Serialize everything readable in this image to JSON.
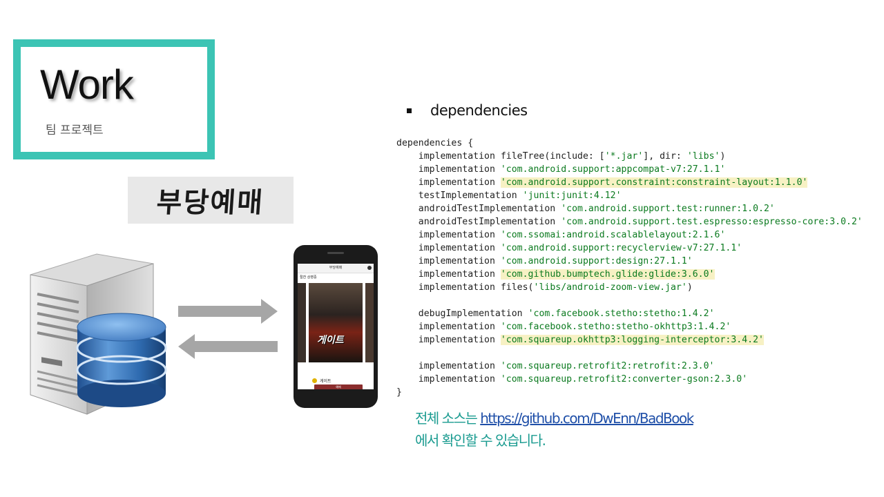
{
  "title": "Work",
  "subtitle": "팀 프로젝트",
  "logo_text": "부당예매",
  "dependencies_heading": "dependencies",
  "code_lines": [
    {
      "text": "dependencies {"
    },
    {
      "text": "    implementation fileTree(include: ['*.jar'], dir: 'libs')"
    },
    {
      "text": "    implementation 'com.android.support:appcompat-v7:27.1.1'"
    },
    {
      "text": "    implementation 'com.android.support.constraint:constraint-layout:1.1.0'",
      "highlight": true
    },
    {
      "text": "    testImplementation 'junit:junit:4.12'"
    },
    {
      "text": "    androidTestImplementation 'com.android.support.test:runner:1.0.2'"
    },
    {
      "text": "    androidTestImplementation 'com.android.support.test.espresso:espresso-core:3.0.2'"
    },
    {
      "text": "    implementation 'com.ssomai:android.scalablelayout:2.1.6'"
    },
    {
      "text": "    implementation 'com.android.support:recyclerview-v7:27.1.1'"
    },
    {
      "text": "    implementation 'com.android.support:design:27.1.1'"
    },
    {
      "text": "    implementation 'com.github.bumptech.glide:glide:3.6.0'",
      "highlight": true
    },
    {
      "text": "    implementation files('libs/android-zoom-view.jar')"
    },
    {
      "text": ""
    },
    {
      "text": "    debugImplementation 'com.facebook.stetho:stetho:1.4.2'"
    },
    {
      "text": "    implementation 'com.facebook.stetho:stetho-okhttp3:1.4.2'"
    },
    {
      "text": "    implementation 'com.squareup.okhttp3:logging-interceptor:3.4.2'",
      "highlight": true
    },
    {
      "text": ""
    },
    {
      "text": "    implementation 'com.squareup.retrofit2:retrofit:2.3.0'"
    },
    {
      "text": "    implementation 'com.squareup.retrofit2:converter-gson:2.3.0'"
    },
    {
      "text": "}"
    }
  ],
  "footer": {
    "prefix": "전체 소스는 ",
    "link": "https://github.com/DwEnn/BadBook",
    "line2": "에서 확인할 수 있습니다."
  },
  "phone": {
    "app_title": "부당예매",
    "section_label": "절찬 상영중",
    "poster_title": "게이트",
    "movie_name": "게이트",
    "book_button": "예매"
  },
  "colors": {
    "frame": "#3cc4b4",
    "footer_text": "#1a9b90",
    "link": "#1f4fa8",
    "code_string": "#0b7a1f",
    "highlight": "#f7f1c4"
  },
  "icons": [
    "server-icon",
    "database-icon",
    "arrow-right-icon",
    "arrow-left-icon",
    "smartphone-icon"
  ]
}
